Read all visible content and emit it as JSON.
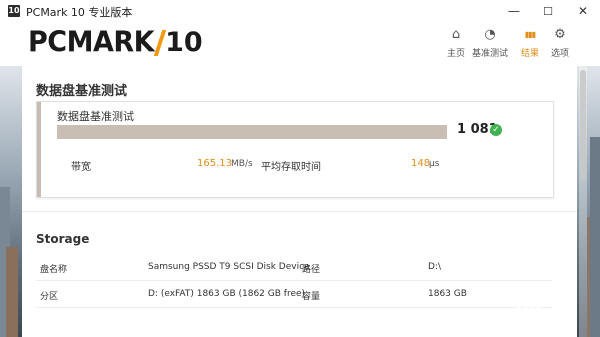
{
  "window": {
    "icon_text": "10",
    "title": "PCMark 10 专业版本",
    "minimize": "—",
    "maximize": "☐",
    "close": "✕"
  },
  "header": {
    "logo_text": "PCMARK",
    "logo_number": "10",
    "nav": [
      {
        "label": "主页",
        "icon": "home-icon",
        "glyph": "⌂"
      },
      {
        "label": "基准测试",
        "icon": "gauge-icon",
        "glyph": "◔"
      },
      {
        "label": "结果",
        "icon": "bar-chart-icon",
        "glyph": "▮▮▮"
      },
      {
        "label": "选项",
        "icon": "gear-icon",
        "glyph": "⚙"
      }
    ],
    "active_tab": "结果"
  },
  "result": {
    "section_title": "数据盘基准测试",
    "card_title": "数据盘基准测试",
    "score": "1 081",
    "score_fill_fraction": 1.0,
    "bandwidth_label": "带宽",
    "bandwidth_value": "165.13",
    "bandwidth_unit": "MB/s",
    "access_label": "平均存取时间",
    "access_value": "148",
    "access_unit": "μs"
  },
  "storage": {
    "title": "Storage",
    "disk_name_label": "盘名称",
    "disk_name_value": "Samsung PSSD T9 SCSI Disk Device",
    "path_label": "路径",
    "path_value": "D:\\",
    "partition_label": "分区",
    "partition_value": "D: (exFAT) 1863 GB (1862 GB free)",
    "capacity_label": "容量",
    "capacity_value": "1863 GB"
  },
  "watermark": {
    "logo": "ZOL",
    "sub": "中关村在线"
  },
  "colors": {
    "accent": "#e08d1b",
    "score_bar": "#c9beb3",
    "check": "#3fb34f"
  }
}
